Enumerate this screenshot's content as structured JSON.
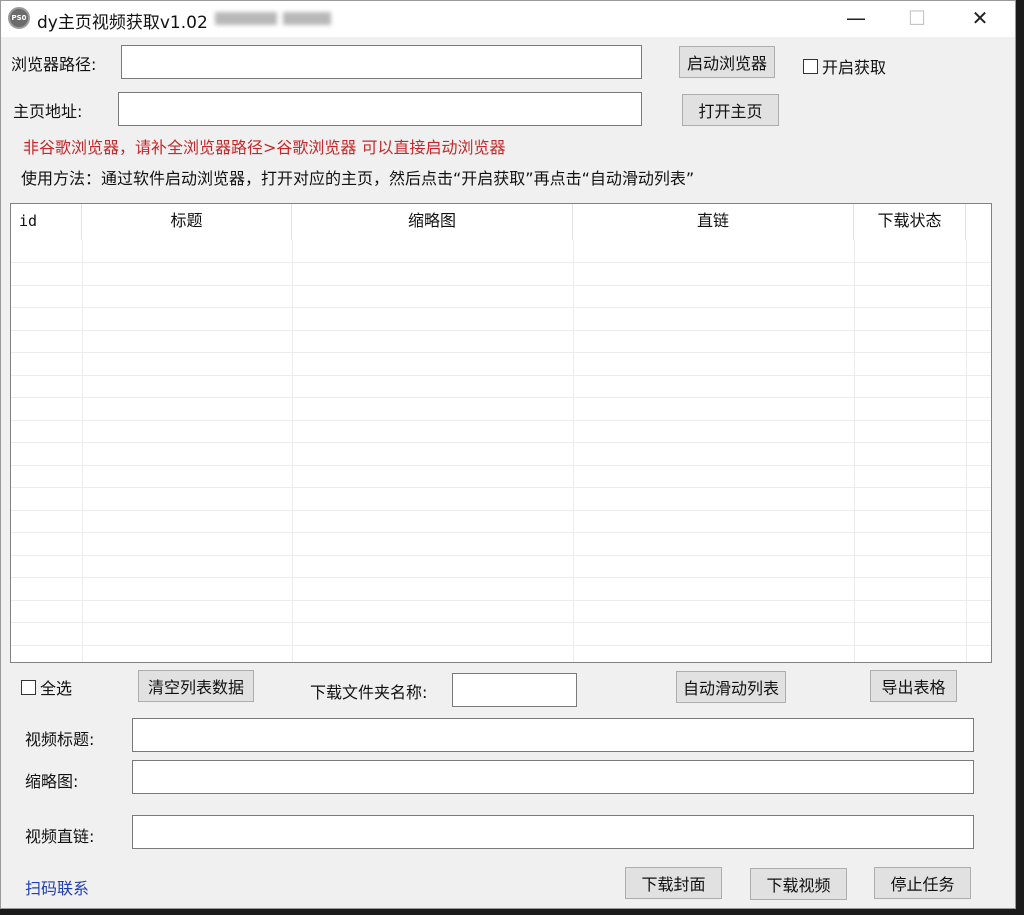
{
  "window": {
    "title": "dy主页视频获取v1.02",
    "app_icon_text": "PS0"
  },
  "top": {
    "browser_path_label": "浏览器路径:",
    "browser_path_value": "",
    "launch_browser_button": "启动浏览器",
    "enable_fetch_label": "开启获取",
    "homepage_label": "主页地址:",
    "homepage_value": "",
    "open_homepage_button": "打开主页",
    "warning_text": "非谷歌浏览器，请补全浏览器路径>谷歌浏览器 可以直接启动浏览器",
    "usage_text": "使用方法：通过软件启动浏览器，打开对应的主页，然后点击“开启获取”再点击“自动滑动列表”"
  },
  "table": {
    "columns": [
      "id",
      "标题",
      "缩略图",
      "直链",
      "下载状态"
    ],
    "rows": []
  },
  "actions": {
    "select_all_label": "全选",
    "clear_list_button": "清空列表数据",
    "folder_name_label": "下载文件夹名称:",
    "folder_name_value": "",
    "auto_scroll_button": "自动滑动列表",
    "export_button": "导出表格"
  },
  "details": {
    "video_title_label": "视频标题:",
    "video_title_value": "",
    "thumbnail_label": "缩略图:",
    "thumbnail_value": "",
    "video_link_label": "视频直链:",
    "video_link_value": ""
  },
  "footer": {
    "contact_link": "扫码联系",
    "download_cover_button": "下载封面",
    "download_video_button": "下载视频",
    "stop_task_button": "停止任务"
  },
  "colors": {
    "warning": "#c62828",
    "link": "#1f3fb5",
    "window_bg": "#f0f0f0",
    "button_bg": "#e1e1e1"
  }
}
